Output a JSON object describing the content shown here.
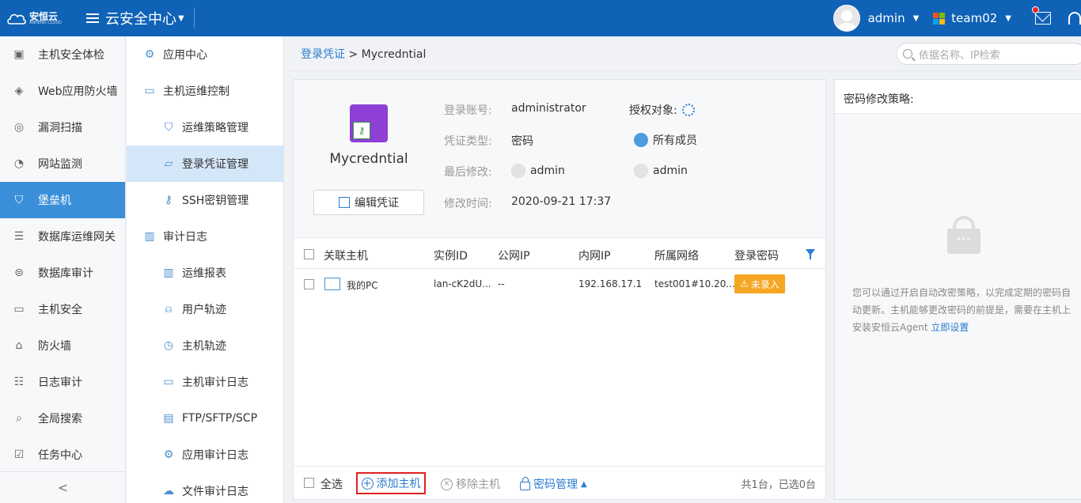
{
  "topbar": {
    "logo_text": "安恒云",
    "logo_sub": "ANHENG CLOUD",
    "menu_title": "云安全中心",
    "user": "admin",
    "team": "team02",
    "menu_icon": "hamburger-icon",
    "brand_color": "#0f62b6"
  },
  "side1": {
    "items": [
      {
        "label": "主机安全体检",
        "icon": "host-check-icon"
      },
      {
        "label": "Web应用防火墙",
        "icon": "waf-icon"
      },
      {
        "label": "漏洞扫描",
        "icon": "scan-icon"
      },
      {
        "label": "网站监测",
        "icon": "monitor-gauge-icon"
      },
      {
        "label": "堡垒机",
        "icon": "shield-icon",
        "active": true
      },
      {
        "label": "数据库运维网关",
        "icon": "database-icon"
      },
      {
        "label": "数据库审计",
        "icon": "db-audit-icon"
      },
      {
        "label": "主机安全",
        "icon": "host-icon"
      },
      {
        "label": "防火墙",
        "icon": "firewall-icon"
      },
      {
        "label": "日志审计",
        "icon": "log-audit-icon"
      },
      {
        "label": "全局搜索",
        "icon": "search-icon"
      },
      {
        "label": "任务中心",
        "icon": "task-icon"
      }
    ],
    "collapse_label": "<"
  },
  "side2": {
    "items": [
      {
        "label": "应用中心",
        "icon": "app-center-icon",
        "sub": false
      },
      {
        "label": "主机运维控制",
        "icon": "host-ops-icon",
        "sub": false
      },
      {
        "label": "运维策略管理",
        "icon": "strategy-shield-icon",
        "sub": true
      },
      {
        "label": "登录凭证管理",
        "icon": "credential-icon",
        "sub": true,
        "active": true
      },
      {
        "label": "SSH密钥管理",
        "icon": "ssh-key-icon",
        "sub": true
      },
      {
        "label": "审计日志",
        "icon": "audit-log-icon",
        "sub": false
      },
      {
        "label": "运维报表",
        "icon": "report-icon",
        "sub": true
      },
      {
        "label": "用户轨迹",
        "icon": "user-track-icon",
        "sub": true
      },
      {
        "label": "主机轨迹",
        "icon": "host-track-icon",
        "sub": true
      },
      {
        "label": "主机审计日志",
        "icon": "host-audit-icon",
        "sub": true
      },
      {
        "label": "FTP/SFTP/SCP",
        "icon": "ftp-icon",
        "sub": true
      },
      {
        "label": "应用审计日志",
        "icon": "app-audit-icon",
        "sub": true
      },
      {
        "label": "文件审计日志",
        "icon": "file-audit-icon",
        "sub": true
      }
    ]
  },
  "breadcrumb": {
    "parent": "登录凭证",
    "separator": ">",
    "current": "Mycredntial"
  },
  "search": {
    "placeholder": "依据名称、IP检索"
  },
  "credential": {
    "name": "Mycredntial",
    "edit_label": "编辑凭证",
    "fields": {
      "account_label": "登录账号:",
      "account_value": "administrator",
      "type_label": "凭证类型:",
      "type_value": "密码",
      "modified_label": "最后修改:",
      "modified_value": "admin",
      "time_label": "修改时间:",
      "time_value": "2020-09-21 17:37",
      "auth_label": "授权对象:",
      "members_value": "所有成员",
      "auth_user": "admin"
    }
  },
  "table": {
    "headers": [
      "关联主机",
      "实例ID",
      "公网IP",
      "内网IP",
      "所属网络",
      "登录密码"
    ],
    "rows": [
      {
        "host": "我的PC",
        "instance": "lan-cK2dU...",
        "public_ip": "--",
        "private_ip": "192.168.17.1",
        "network": "test001#10.20....",
        "password": "未录入"
      }
    ]
  },
  "footer": {
    "select_all": "全选",
    "add": "添加主机",
    "remove": "移除主机",
    "password_manage": "密码管理",
    "summary": "共1台，已选0台"
  },
  "right_panel": {
    "title": "密码修改策略:",
    "text": "您可以通过开启自动改密策略，以完成定期的密码自动更新。主机能够更改密码的前提是，需要在主机上安装安恒云Agent",
    "link": "立即设置"
  }
}
